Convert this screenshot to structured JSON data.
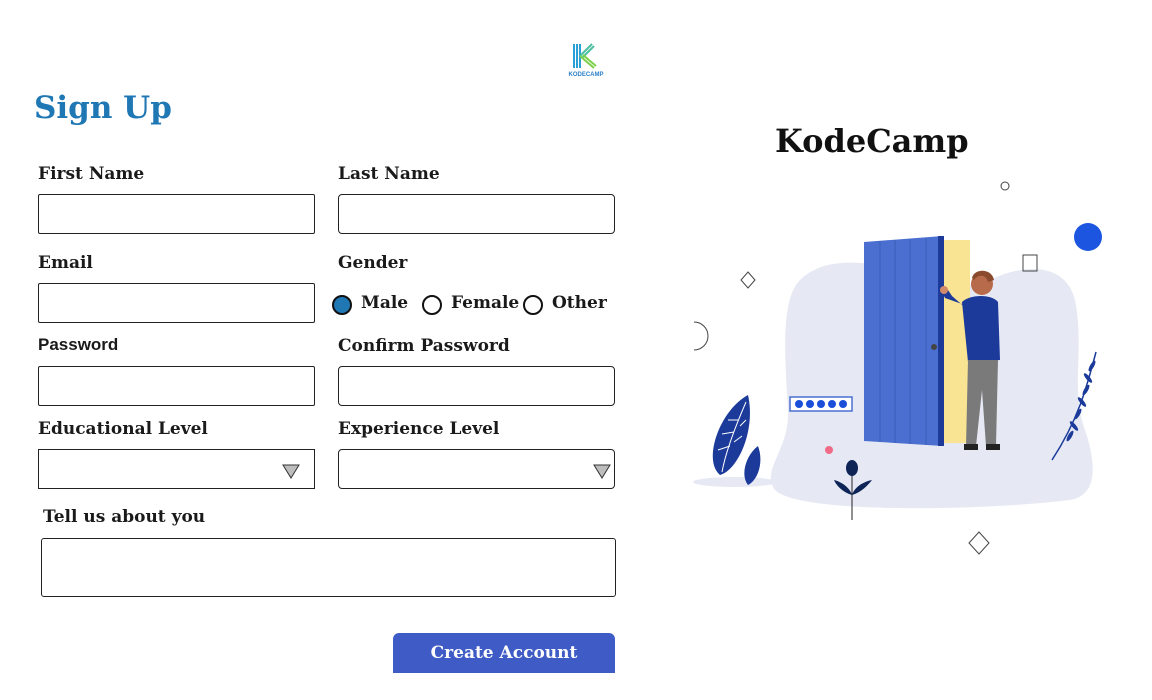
{
  "header": {
    "logo_text": "KODECAMP"
  },
  "form": {
    "title": "Sign Up",
    "first_name": {
      "label": "First Name",
      "value": ""
    },
    "last_name": {
      "label": "Last Name",
      "value": ""
    },
    "email": {
      "label": "Email",
      "value": ""
    },
    "gender": {
      "label": "Gender",
      "options": [
        "Male",
        "Female",
        "Other"
      ],
      "selected": "Male"
    },
    "password": {
      "label": "Password",
      "value": ""
    },
    "confirm_password": {
      "label": "Confirm Password",
      "value": ""
    },
    "educational_level": {
      "label": "Educational Level",
      "value": ""
    },
    "experience_level": {
      "label": "Experience Level",
      "value": ""
    },
    "about": {
      "label": "Tell us about you",
      "value": ""
    },
    "submit_label": "Create Account"
  },
  "side": {
    "title": "KodeCamp"
  },
  "colors": {
    "accent": "#1f77b4",
    "button": "#3e5bc6",
    "illustration_blue": "#4a6fd0",
    "door_frame": "#f9e494"
  }
}
